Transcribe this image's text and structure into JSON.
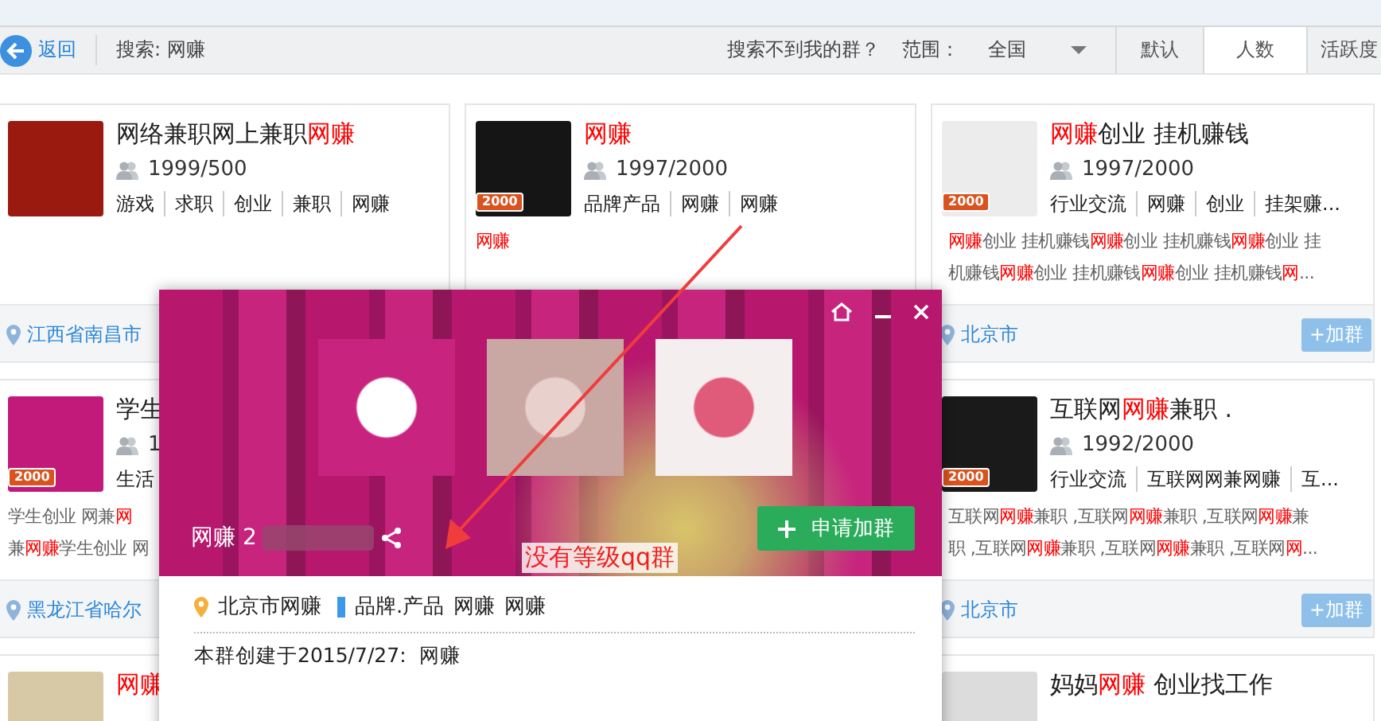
{
  "toolbar": {
    "back_label": "返回",
    "search_label": "搜索: 网赚",
    "help_link": "搜索不到我的群？",
    "scope_label": "范围：",
    "scope_value": "全国"
  },
  "sort_tabs": [
    {
      "label": "默认",
      "selected": false
    },
    {
      "label": "人数",
      "selected": true
    },
    {
      "label": "活跃度",
      "selected": false
    }
  ],
  "columns": [
    [
      {
        "title": "网络兼职网上兼职**网赚**",
        "members": "1999/500",
        "tags": [
          "游戏",
          "求职",
          "创业",
          "兼职",
          "网赚"
        ],
        "location": "江西省南昌市"
      },
      {
        "title": "学生",
        "badge": "2000",
        "members": "1",
        "tags": [
          "生活"
        ],
        "description_lines": [
          "学生创业 网兼**网**",
          "兼**网赚**学生创业 网"
        ],
        "location": "黑龙江省哈尔"
      },
      {
        "title": "**网赚**"
      }
    ],
    [
      {
        "title": "**网赚**",
        "badge": "2000",
        "members": "1997/2000",
        "tags": [
          "品牌产品",
          "网赚",
          "网赚"
        ],
        "description_lines": [
          "**网赚**"
        ]
      }
    ],
    [
      {
        "title": "**网赚**创业 挂机赚钱",
        "badge": "2000",
        "members": "1997/2000",
        "tags": [
          "行业交流",
          "网赚",
          "创业",
          "挂架赚..."
        ],
        "description_lines": [
          "**网赚**创业 挂机赚钱**网赚**创业 挂机赚钱**网赚**创业 挂",
          "机赚钱**网赚**创业 挂机赚钱**网赚**创业 挂机赚钱**网**..."
        ],
        "location": "北京市",
        "join_button": "+加群"
      },
      {
        "title": "互联网**网赚**兼职 .",
        "badge": "2000",
        "members": "1992/2000",
        "tags": [
          "行业交流",
          "互联网网兼网赚",
          "互..."
        ],
        "description_lines": [
          "互联网**网赚**兼职 ,互联网**网赚**兼职 ,互联网**网赚**兼",
          "职 ,互联网**网赚**兼职 ,互联网**网赚**兼职 ,互联网**网**..."
        ],
        "location": "北京市",
        "join_button": "+加群"
      },
      {
        "title": "妈妈**网赚** 创业找工作"
      }
    ]
  ],
  "popup": {
    "name": "网赚 2",
    "join_button": "申请加群",
    "location": "北京市网赚",
    "tags": [
      "品牌.产品",
      "网赚",
      "网赚"
    ],
    "created": "本群创建于2015/7/27:  网赚"
  },
  "annotation": {
    "text": "没有等级qq群"
  }
}
